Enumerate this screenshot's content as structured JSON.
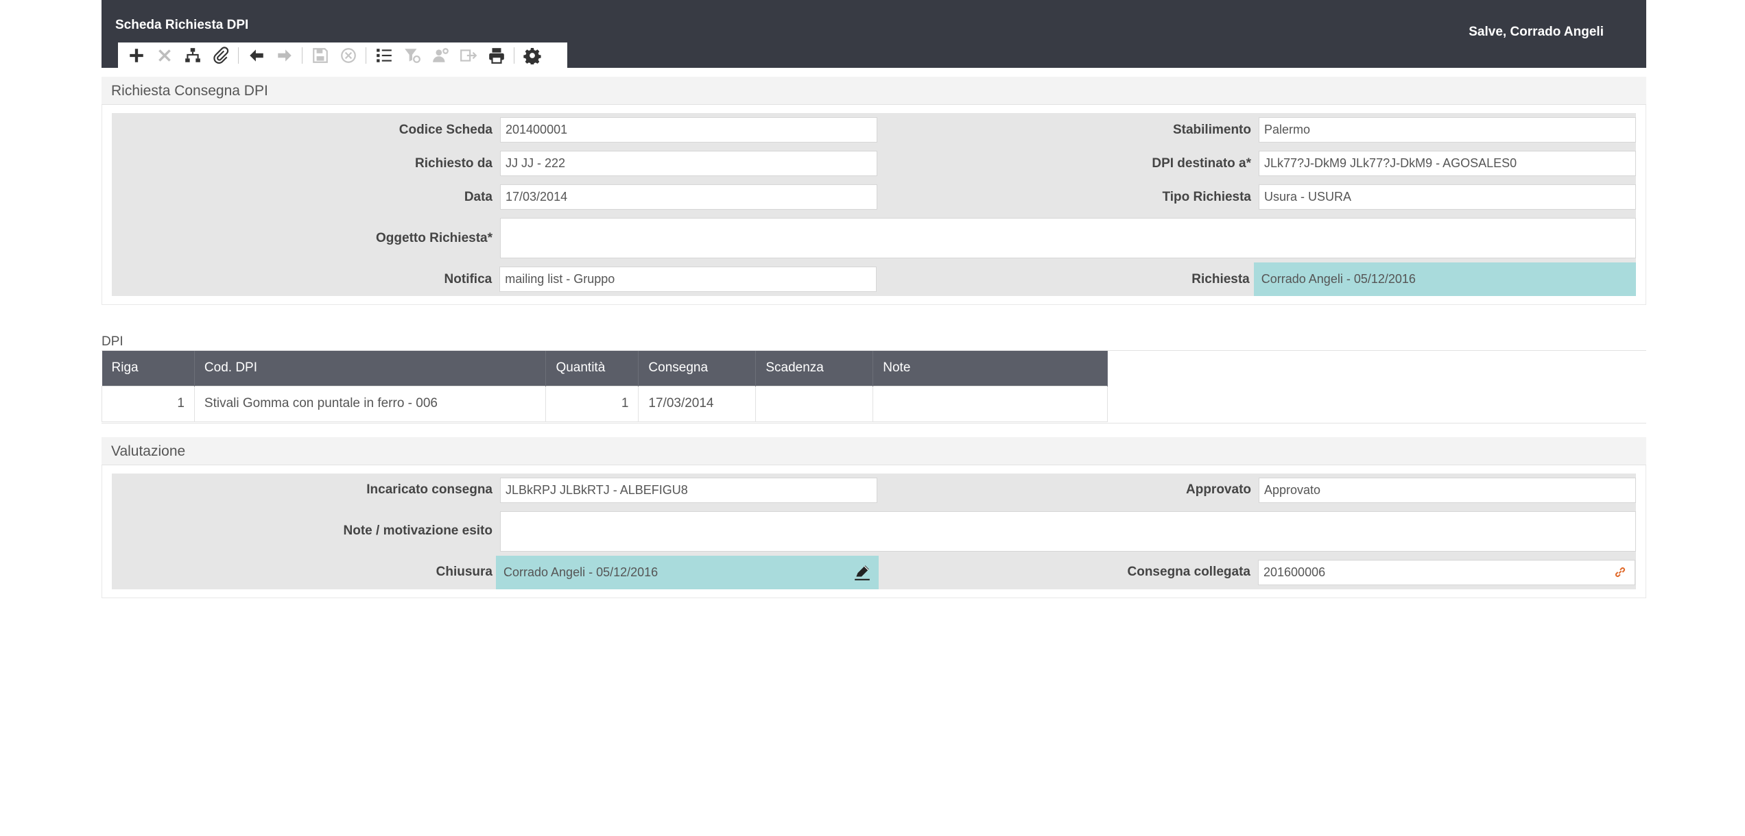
{
  "header": {
    "title": "Scheda Richiesta DPI",
    "greeting": "Salve, Corrado Angeli"
  },
  "toolbar": {
    "icons": [
      "plus-icon",
      "delete-icon",
      "hierarchy-icon",
      "attachment-icon",
      "arrow-left-icon",
      "arrow-right-icon",
      "save-icon",
      "cancel-icon",
      "list-icon",
      "filter-icon",
      "user-settings-icon",
      "export-icon",
      "print-icon",
      "gear-icon"
    ]
  },
  "richiesta": {
    "section_title": "Richiesta Consegna DPI",
    "codice_scheda_label": "Codice Scheda",
    "codice_scheda_value": "201400001",
    "stabilimento_label": "Stabilimento",
    "stabilimento_value": "Palermo",
    "richiesto_da_label": "Richiesto da",
    "richiesto_da_value": "JJ JJ - 222",
    "dpi_destinato_label": "DPI destinato a*",
    "dpi_destinato_value": "JLk77?J-DkM9 JLk77?J-DkM9 - AGOSALES0",
    "data_label": "Data",
    "data_value": "17/03/2014",
    "tipo_richiesta_label": "Tipo Richiesta",
    "tipo_richiesta_value": "Usura - USURA",
    "oggetto_label": "Oggetto Richiesta*",
    "oggetto_value": "",
    "notifica_label": "Notifica",
    "notifica_value": "mailing list - Gruppo",
    "richiesta_label": "Richiesta",
    "richiesta_value": "Corrado Angeli - 05/12/2016"
  },
  "dpi": {
    "caption": "DPI",
    "columns": [
      "Riga",
      "Cod. DPI",
      "Quantità",
      "Consegna",
      "Scadenza",
      "Note"
    ],
    "rows": [
      {
        "riga": "1",
        "cod": "Stivali Gomma con puntale in ferro - 006",
        "quantita": "1",
        "consegna": "17/03/2014",
        "scadenza": "",
        "note": ""
      }
    ]
  },
  "valutazione": {
    "section_title": "Valutazione",
    "incaricato_label": "Incaricato consegna",
    "incaricato_value": "JLBkRPJ JLBkRTJ - ALBEFIGU8",
    "approvato_label": "Approvato",
    "approvato_value": "Approvato",
    "note_label": "Note / motivazione esito",
    "note_value": "",
    "chiusura_label": "Chiusura",
    "chiusura_value": "Corrado Angeli - 05/12/2016",
    "consegna_collegata_label": "Consegna collegata",
    "consegna_collegata_value": "201600006"
  },
  "colors": {
    "header_bg": "#383b44",
    "table_header_bg": "#5b5e68",
    "highlight_teal": "#a9dbdc",
    "link_icon": "#e06a2b"
  }
}
